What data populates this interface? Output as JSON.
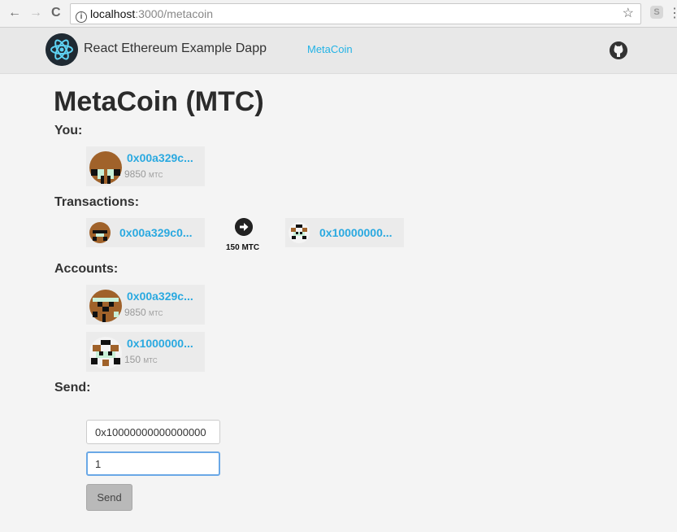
{
  "browser": {
    "host": "localhost",
    "path": ":3000/metacoin",
    "back_glyph": "←",
    "forward_glyph": "→",
    "reload_glyph": "C",
    "star_glyph": "☆",
    "menu_glyph": "⋮"
  },
  "navbar": {
    "brand": "React Ethereum Example Dapp",
    "link": "MetaCoin"
  },
  "page": {
    "title": "MetaCoin (MTC)"
  },
  "sections": {
    "you": "You:",
    "transactions": "Transactions:",
    "accounts": "Accounts:",
    "send": "Send:"
  },
  "you": {
    "address": "0x00a329c...",
    "balance": "9850",
    "unit": "MTC"
  },
  "transaction": {
    "from": "0x00a329c0...",
    "to": "0x10000000...",
    "amount": "150",
    "unit": "MTC"
  },
  "accounts": [
    {
      "address": "0x00a329c...",
      "balance": "9850",
      "unit": "MTC"
    },
    {
      "address": "0x1000000...",
      "balance": "150",
      "unit": "MTC"
    }
  ],
  "send_form": {
    "to_value": "0x10000000000000000",
    "amount_value": "1",
    "button": "Send"
  },
  "colors": {
    "accent": "#2aa9e0",
    "avatar_brown": "#a0622a",
    "avatar_mint": "#c8f0d8"
  }
}
